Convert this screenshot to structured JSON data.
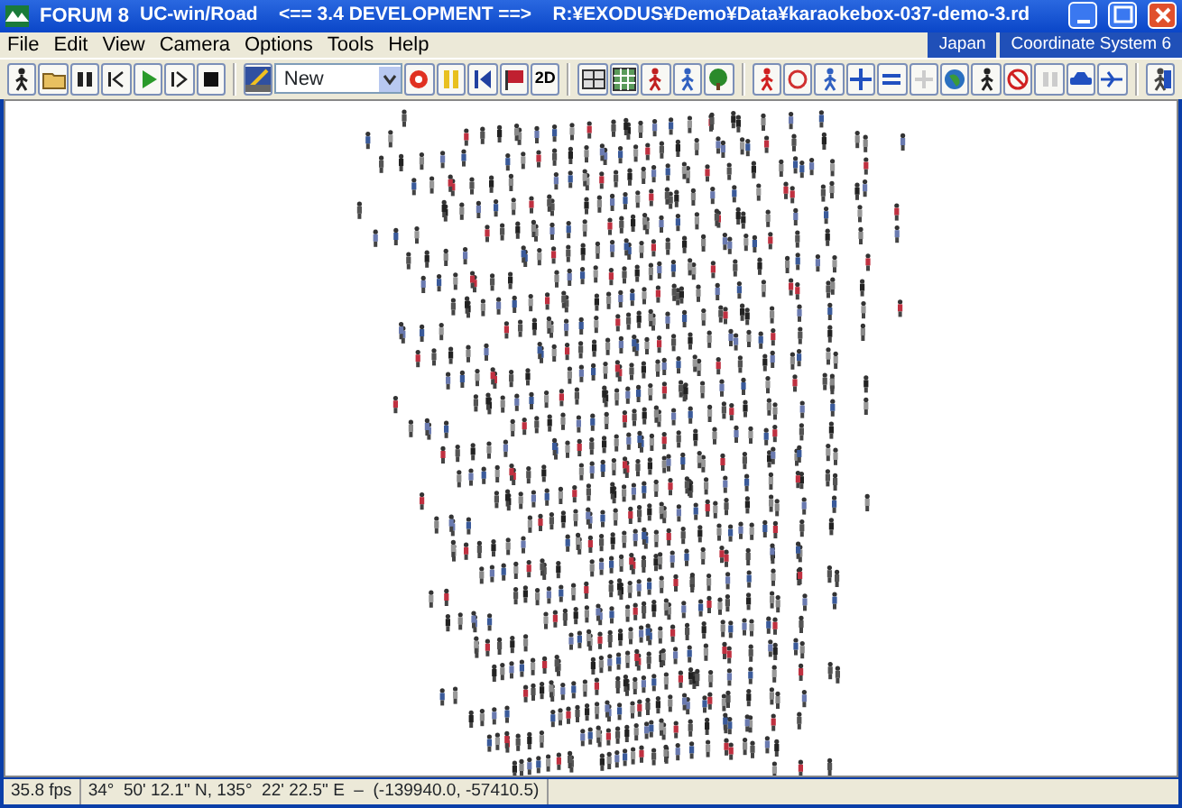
{
  "window": {
    "brand": "FORUM 8",
    "title": "UC-win/Road    <== 3.4 DEVELOPMENT ==>    R:¥EXODUS¥Demo¥Data¥karaokebox-037-demo-3.rd"
  },
  "menu": [
    "File",
    "Edit",
    "View",
    "Camera",
    "Options",
    "Tools",
    "Help"
  ],
  "menu_right": [
    "Japan",
    "Coordinate System 6"
  ],
  "toolbar": {
    "combo_value": "New",
    "view_button": "2D"
  },
  "status_bar": [
    "35.8 fps",
    "34°  50' 12.1\" N, 135°  22' 22.5\" E  –  (-139940.0, -57410.5)"
  ]
}
